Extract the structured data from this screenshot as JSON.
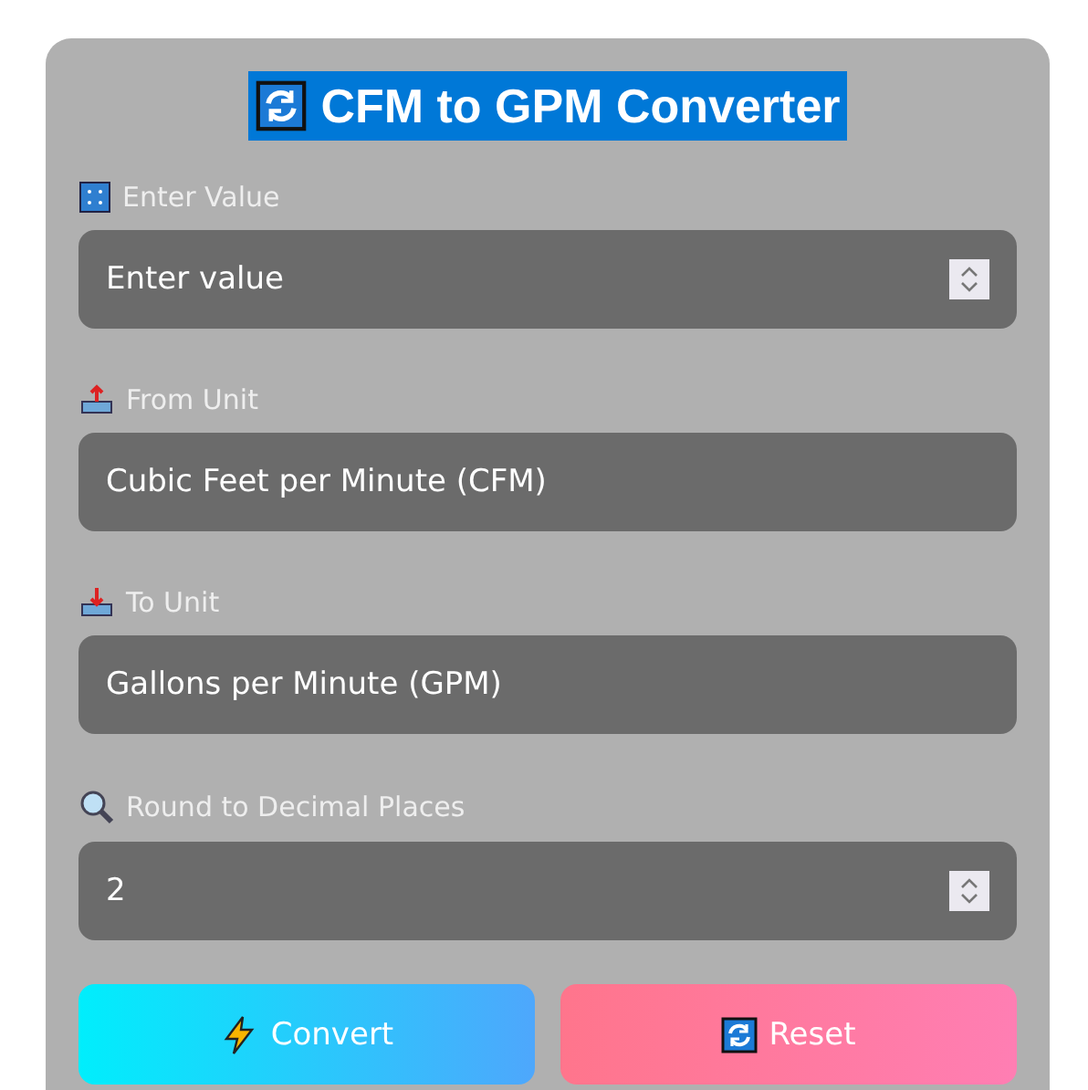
{
  "title": {
    "text": "CFM to GPM Converter",
    "highlighted": true
  },
  "fields": [
    {
      "label": "Enter Value",
      "kind": "number",
      "placeholder": "Enter value"
    },
    {
      "label": "From Unit",
      "kind": "select",
      "value": "Cubic Feet per Minute (CFM)"
    },
    {
      "label": "To Unit",
      "kind": "select",
      "value": "Gallons per Minute (GPM)"
    },
    {
      "label": "Round to Decimal Places",
      "kind": "number",
      "value": "2"
    }
  ],
  "buttons": [
    {
      "label": "Convert",
      "kind": "primary"
    },
    {
      "label": "Reset",
      "kind": "secondary"
    }
  ]
}
